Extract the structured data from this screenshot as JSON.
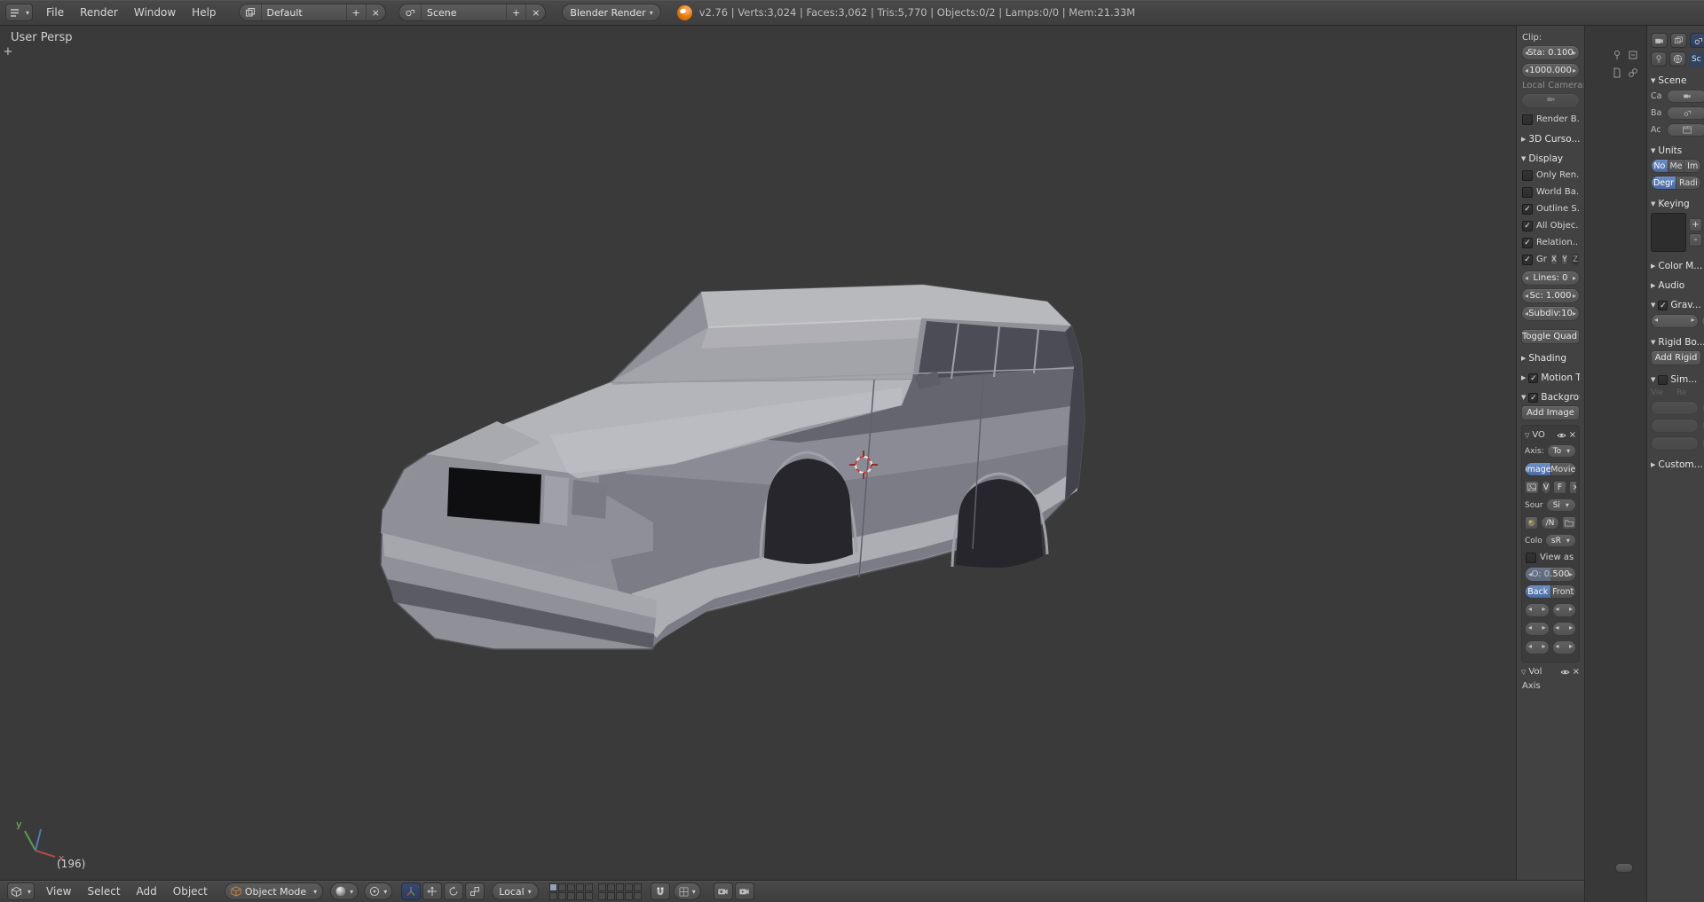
{
  "colors": {
    "accent_blue": "#49699f",
    "header_bg": "#434343",
    "viewport_bg": "#3a3a3a",
    "panel_bg": "#424242",
    "button_bg": "#565656",
    "blender_orange": "#e87d0d",
    "car_body_light": "#b5b6ba",
    "car_body_shadow": "#64656f",
    "cursor_red": "#c83c3c"
  },
  "glyphs": {
    "plus": "+",
    "minus": "-",
    "close": "×",
    "dd": "▾",
    "left": "◂",
    "right": "▸",
    "tri_open": "▼",
    "tri_closed": "▶",
    "tri_item": "▽",
    "check": "✓"
  },
  "topbar": {
    "menus": [
      {
        "label": "File"
      },
      {
        "label": "Render"
      },
      {
        "label": "Window"
      },
      {
        "label": "Help"
      }
    ],
    "layout_name": "Default",
    "scene_name": "Scene",
    "engine": "Blender Render",
    "stats": "v2.76 | Verts:3,024 | Faces:3,062 | Tris:5,770 | Objects:0/2 | Lamps:0/0 | Mem:21.33M"
  },
  "viewport": {
    "view_label": "User Persp",
    "frame_label": "(196)",
    "axis_x": "x",
    "axis_y": "y",
    "toolshelf_expand": "+"
  },
  "view3d_header": {
    "menus": [
      {
        "label": "View"
      },
      {
        "label": "Select"
      },
      {
        "label": "Add"
      },
      {
        "label": "Object"
      }
    ],
    "mode": "Object Mode",
    "orientation": "Local"
  },
  "npanel": {
    "clip_label": "Clip:",
    "clip_start": "Sta: 0.100",
    "clip_end": "1000.000",
    "local_camera_label": "Local Camera:",
    "render_border_label": "Render B...",
    "cursor_panel": "3D Curso...",
    "display_panel": "Display",
    "toggles": [
      {
        "label": "Only Ren...",
        "checked": false
      },
      {
        "label": "World Ba...",
        "checked": false
      },
      {
        "label": "Outline S...",
        "checked": true
      },
      {
        "label": "All Objec...",
        "checked": true
      },
      {
        "label": "Relation...",
        "checked": true
      }
    ],
    "grid_label": "Gr",
    "axis_x": "X",
    "axis_y": "Y",
    "axis_z": "Z",
    "lines_field": "Lines: 0",
    "scale_field": "Sc: 1.000",
    "subdiv_field": "Subdiv:10",
    "toggle_quad_button": "Toggle Quad ...",
    "shading_panel": "Shading",
    "motion_panel": "Motion Tr...",
    "background_panel": "Backgrou...",
    "add_image_button": "Add Image",
    "bg_image": {
      "name": "VO",
      "axis_label": "Axis:",
      "axis_value": "To",
      "image_toggle": "Image",
      "movie_toggle": "Movie",
      "datablock_name": "V",
      "fake_user": "F",
      "source_label": "Sour",
      "source_value": "Si",
      "filepath": "/N",
      "colorspace_label": "Colo",
      "colorspace_value": "sR",
      "view_as_label": "View as",
      "opacity_field": "O: 0.500",
      "back_toggle": "Back",
      "front_toggle": "Front"
    },
    "bg_image2": {
      "name": "Vol",
      "axis_label": "Axis"
    }
  },
  "properties": {
    "tab_hint": "Sc",
    "scene_panel": "Scene",
    "camera_label": "Ca",
    "background_label": "Ba",
    "active_clip_label": "Ac",
    "units_panel": "Units",
    "unit_none": "No",
    "unit_metric": "Me",
    "unit_imperial": "Im",
    "rot_degrees": "Degr",
    "rot_radians": "Radi",
    "keying_panel": "Keying",
    "color_panel": "Color M...",
    "audio_panel": "Audio",
    "gravity_panel": "Grav...",
    "rigid_panel": "Rigid Bo...",
    "add_rigid_button": "Add Rigid",
    "simplify_panel": "Sim...",
    "simplify_viewport": "Vie",
    "simplify_render": "Re",
    "custom_panel": "Custom..."
  }
}
